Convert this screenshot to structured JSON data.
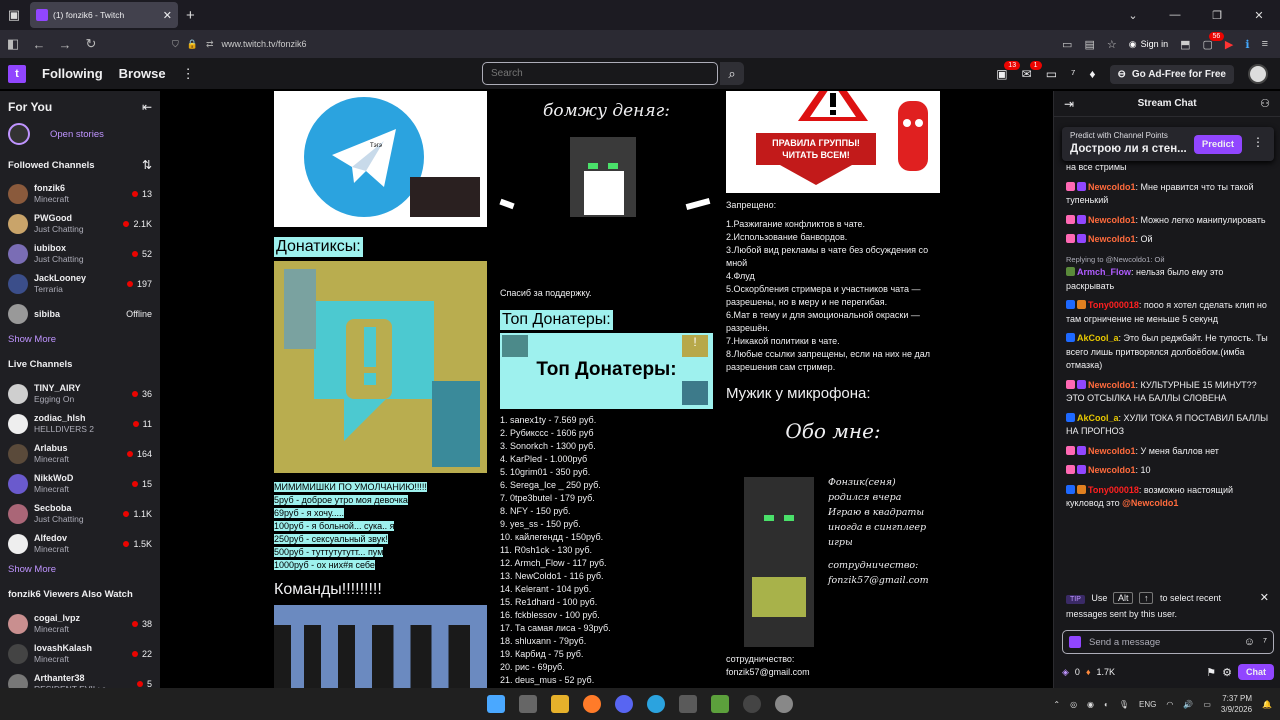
{
  "browser": {
    "tab_title": "(1) fonzik6 - Twitch",
    "url": "www.twitch.tv/fonzik6",
    "sign_in": "Sign in",
    "ext_badge": "56"
  },
  "topnav": {
    "following": "Following",
    "browse": "Browse",
    "search_placeholder": "Search",
    "notif_count": "13",
    "inbox_count": "1",
    "ad_free": "Go Ad-Free for Free"
  },
  "sidebar": {
    "for_you": "For You",
    "open_stories": "Open stories",
    "followed_title": "Followed Channels",
    "followed": [
      {
        "name": "fonzik6",
        "game": "Minecraft",
        "viewers": "13",
        "color": "#8a5a3c"
      },
      {
        "name": "PWGood",
        "game": "Just Chatting",
        "viewers": "2.1K",
        "color": "#c9a46a"
      },
      {
        "name": "iubibox",
        "game": "Just Chatting",
        "viewers": "52",
        "color": "#7a6db5"
      },
      {
        "name": "JackLooney",
        "game": "Terraria",
        "viewers": "197",
        "color": "#3b4e8a"
      },
      {
        "name": "sibiba",
        "game": "",
        "viewers": "Offline",
        "color": "#999"
      }
    ],
    "show_more": "Show More",
    "live_title": "Live Channels",
    "live": [
      {
        "name": "TINY_AIRY",
        "game": "Egging On",
        "viewers": "36",
        "color": "#cfcfcf"
      },
      {
        "name": "zodiac_hlsh",
        "game": "HELLDIVERS 2",
        "viewers": "11",
        "color": "#eee"
      },
      {
        "name": "Arlabus",
        "game": "Minecraft",
        "viewers": "164",
        "color": "#5a4a3a"
      },
      {
        "name": "NikkWoD",
        "game": "Minecraft",
        "viewers": "15",
        "color": "#6a5acd"
      },
      {
        "name": "Secboba",
        "game": "Just Chatting",
        "viewers": "1.1K",
        "color": "#aa6677"
      },
      {
        "name": "Alfedov",
        "game": "Minecraft",
        "viewers": "1.5K",
        "color": "#eee"
      }
    ],
    "show_more2": "Show More",
    "also_title": "fonzik6 Viewers Also Watch",
    "also": [
      {
        "name": "cogai_lvpz",
        "game": "Minecraft",
        "viewers": "38",
        "color": "#c98f8f"
      },
      {
        "name": "lovashKalash",
        "game": "Minecraft",
        "viewers": "22",
        "color": "#444"
      },
      {
        "name": "Arthanter38",
        "game": "RESIDENT EVIL: r...",
        "viewers": "5",
        "color": "#777"
      }
    ]
  },
  "panels": {
    "col1_title": "Донатиксы:",
    "tg_label": "Тэгэ",
    "donate_list": [
      "МИМИМИШКИ ПО УМОЛЧАНИЮ!!!!!",
      "5руб - доброе утро моя девочка",
      "69руб - я хочу.....",
      "100руб - я больной... сука.. я",
      "250руб - сексуальный звук!",
      "500руб - туттутутутт... пум",
      "1000руб - ох них#я себе"
    ],
    "commands": "Команды!!!!!!!!!",
    "col2_top": "бомжу деняг:",
    "thanks": "Спасиб за поддержку.",
    "top_title": "Топ Донатеры:",
    "top_banner": "Топ Донатеры:",
    "top_list": [
      "1. sanex1ty - 7.569 руб.",
      "2. Рубикссс - 1606 руб",
      "3. Sonorkch - 1300 руб.",
      "4. KarPled - 1.000руб",
      "5. 10grim01 - 350 руб.",
      "6. Serega_Ice _ 250 руб.",
      "7. 0tpe3butel - 179 руб.",
      "8. NFY - 150 руб.",
      "9. yes_ss - 150 руб.",
      "10. кайлегендд - 150руб.",
      "11. R0sh1ck - 130 руб.",
      "12. Armch_Flow - 117 руб.",
      "13. NewColdo1 - 116 руб.",
      "14. Kelerant - 104 руб.",
      "15. Re1dhard - 100 руб.",
      "16. fckblessov - 100 руб.",
      "17. Та самая лиса - 93руб.",
      "18. shluxann - 79руб.",
      "19. Карбид - 75 руб.",
      "20. рис - 69руб.",
      "21. deus_mus - 52 руб."
    ],
    "rules_banner": "ПРАВИЛА ГРУППЫ! ЧИТАТЬ ВСЕМ!",
    "forbidden": "Запрещено:",
    "rules": [
      "1.Разжигание конфликтов в чате.",
      "2.Использование банвордов.",
      "3.Любой вид рекламы в чате без обсуждения со мной",
      "4.Флуд",
      "5.Оскорбления стримера и участников чата — разрешены, но в меру и не перегибая.",
      "6.Мат в тему и для эмоциональной окраски — разрешён.",
      "7.Никакой политики в чате.",
      "8.Любые ссылки запрещены, если на них не дал разрешения сам стример."
    ],
    "mic_title": "Мужик у микрофона:",
    "about": "Обо мне:",
    "about_text": [
      "Фонзик(сеня)",
      "родился вчера",
      "Играю в квадраты",
      "иногда в сингплеер",
      "игры",
      "сотрудничество:",
      "fonzik57@gmail.com"
    ],
    "coop": "сотрудничество:",
    "coop_email": "fonzik57@gmail.com"
  },
  "chat": {
    "title": "Stream Chat",
    "predict_label": "Predict with Channel Points",
    "predict_question": "Дострою ли я стен...",
    "predict_btn": "Predict",
    "messages": [
      {
        "reply": "",
        "user": "",
        "color": "#efeff1",
        "text": "на все стримы"
      },
      {
        "reply": "",
        "user": "Newcoldo1",
        "color": "#ff6b3d",
        "text": ": Мне нравится что ты такой тупенький"
      },
      {
        "reply": "",
        "user": "Newcoldo1",
        "color": "#ff6b3d",
        "text": ": Можно легко манипулировать"
      },
      {
        "reply": "",
        "user": "Newcoldo1",
        "color": "#ff6b3d",
        "text": ": Ой"
      },
      {
        "reply": "Replying to @Newcoldo1: Ой",
        "user": "Armch_Flow",
        "color": "#b05cff",
        "text": ": нельзя было ему это раскрывать"
      },
      {
        "reply": "",
        "user": "Tony000018",
        "color": "#ff2020",
        "text": ": пооо я хотел сделать клип но там огрничение не меньше 5 секунд"
      },
      {
        "reply": "",
        "user": "AkCool_a",
        "color": "#e6c700",
        "text": ": Это был реджбайт. Не тупость. Ты всего лишь притворялся долбоёбом.(имба отмазка)"
      },
      {
        "reply": "",
        "user": "Newcoldo1",
        "color": "#ff6b3d",
        "text": ": КУЛЬТУРНЫЕ 15 МИНУТ?? ЭТО ОТСЫЛКА НА БАЛЛЫ СЛОВЕНА"
      },
      {
        "reply": "",
        "user": "AkCool_a",
        "color": "#e6c700",
        "text": ": ХУЛИ ТОКА Я ПОСТАВИЛ БАЛЛЫ НА ПРОГНОЗ"
      },
      {
        "reply": "",
        "user": "Newcoldo1",
        "color": "#ff6b3d",
        "text": ": У меня баллов нет"
      },
      {
        "reply": "",
        "user": "Newcoldo1",
        "color": "#ff6b3d",
        "text": ": 10"
      },
      {
        "reply": "",
        "user": "Tony000018",
        "color": "#ff2020",
        "text": ": возможно настоящий кукловод это "
      }
    ],
    "mention": "@Newcoldo1",
    "tip_badge": "TIP",
    "tip_1": "Use",
    "tip_key1": "Alt",
    "tip_key2": "↑",
    "tip_2": "to select recent messages sent by this user.",
    "send_placeholder": "Send a message",
    "points": "0",
    "bits": "1.7K",
    "chat_btn": "Chat"
  },
  "taskbar": {
    "lang": "ENG",
    "time": "7:37 PM",
    "date": "3/9/2026"
  }
}
